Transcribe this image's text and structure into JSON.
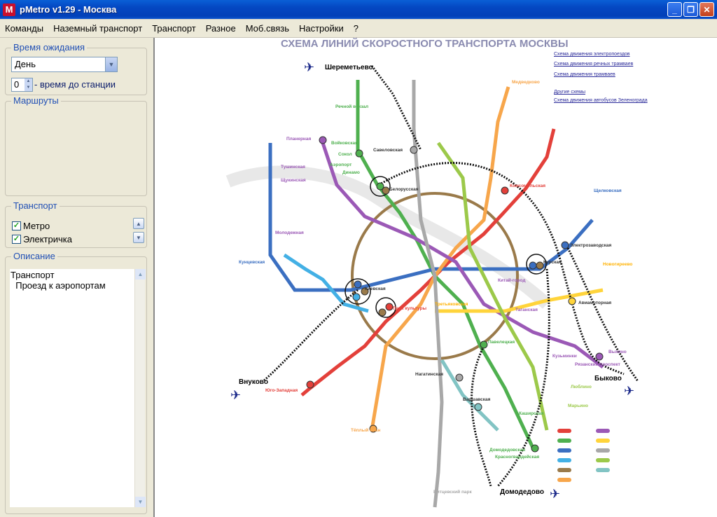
{
  "window": {
    "title": "pMetro v1.29 - Москва",
    "app_icon": "M"
  },
  "menu": [
    "Команды",
    "Наземный транспорт",
    "Транспорт",
    "Разное",
    "Моб.связь",
    "Настройки",
    "?"
  ],
  "wait": {
    "label": "Время ожидания",
    "value": "День",
    "spin_value": "0",
    "spin_label": "- время до станции"
  },
  "routes": {
    "label": "Маршруты"
  },
  "transport": {
    "label": "Транспорт",
    "items": [
      "Метро",
      "Электричка"
    ]
  },
  "description": {
    "label": "Описание",
    "lines": [
      "Транспорт",
      "  Проезд к аэропортам"
    ]
  },
  "map": {
    "title": "СХЕМА ЛИНИЙ СКОРОСТНОГО ТРАНСПОРТА МОСКВЫ",
    "links": [
      "Схема движения электропоездов",
      "Схема движения речных трамваев",
      "Схема движения трамваев",
      "Другие схемы",
      "Схема движения автобусов Зеленограда"
    ],
    "airports": [
      "Шереметьево",
      "Внуково",
      "Быково",
      "Домодедово"
    ],
    "stations": [
      "Белорусская",
      "Комсомольская",
      "Курская",
      "Киевская",
      "Парк культуры",
      "Павелецкая",
      "Савеловская",
      "Сокол",
      "Войковская",
      "Планерная",
      "Юго-Западная",
      "Тёплый Стан",
      "Домодедовская",
      "Варшавская",
      "Нагатинская",
      "Электрозаводская",
      "Рязанский проспект",
      "Выхино",
      "Авиамоторная",
      "Речной вокзал",
      "Динамо",
      "Аэропорт",
      "Кунцевская",
      "Молодежная",
      "Щукинская",
      "Тушинская",
      "Третьяковская",
      "Китай-город",
      "Таганская",
      "Медведково",
      "Щелковская",
      "Новогиреево",
      "Марьино",
      "Каширская",
      "Красногвардейская",
      "Битцевский парк",
      "Кузьминки",
      "Люблино"
    ],
    "colors": {
      "l1": "#e3403a",
      "l2": "#4fb04f",
      "l3": "#3b6fc1",
      "l4": "#43b0e5",
      "l5": "#8b5a2b",
      "l6": "#f7a64b",
      "l7": "#9b59b6",
      "l8": "#ffd43b",
      "l9": "#a8a8a8",
      "l10": "#9cc94a",
      "l11": "#82c4c4"
    }
  }
}
